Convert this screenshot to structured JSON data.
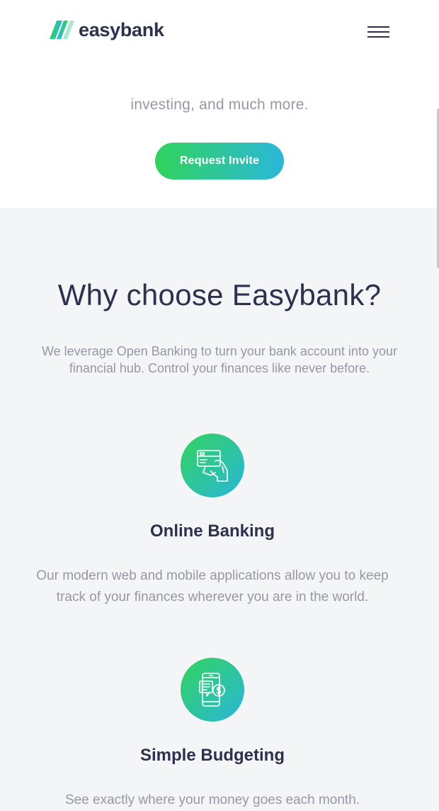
{
  "brand": {
    "name": "easybank",
    "colors": {
      "dark_blue": "#2d314d",
      "lime_green": "#31d35c",
      "bright_cyan": "#2bb7da",
      "grayish_blue": "#9598a6"
    }
  },
  "header": {
    "menu_icon": "hamburger-menu-icon"
  },
  "hero": {
    "text_fragment": "investing, and much more.",
    "cta_label": "Request Invite"
  },
  "why": {
    "title": "Why choose Easybank?",
    "subtitle": "We leverage Open Banking to turn your bank account into your financial hub. Control your finances like never before."
  },
  "features": [
    {
      "icon": "credit-card-hand-icon",
      "title": "Online Banking",
      "text": "Our modern web and mobile applications allow you to keep track of your finances wherever you are in the world."
    },
    {
      "icon": "mobile-budget-icon",
      "title": "Simple Budgeting",
      "text": "See exactly where your money goes each month."
    }
  ]
}
